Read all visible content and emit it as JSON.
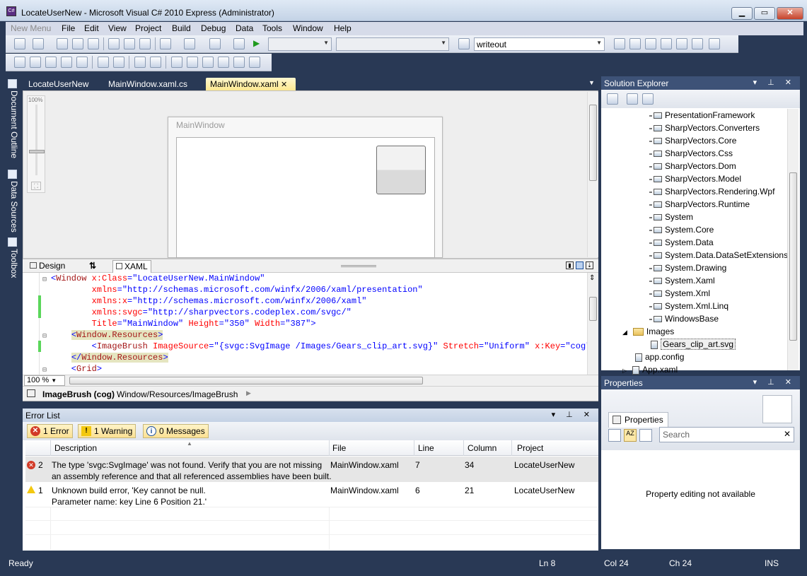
{
  "window": {
    "title": "LocateUserNew - Microsoft Visual C# 2010 Express (Administrator)",
    "app_icon": "C#"
  },
  "menu": {
    "items": [
      "New Menu",
      "File",
      "Edit",
      "View",
      "Project",
      "Build",
      "Debug",
      "Data",
      "Tools",
      "Window",
      "Help"
    ]
  },
  "toolbar": {
    "find_value": "writeout"
  },
  "left_tabs": [
    "Document Outline",
    "Data Sources",
    "Toolbox"
  ],
  "doc_tabs": [
    {
      "label": "LocateUserNew"
    },
    {
      "label": "MainWindow.xaml.cs"
    },
    {
      "label": "MainWindow.xaml",
      "active": true
    }
  ],
  "designer": {
    "zoom_label": "100%",
    "window_title": "MainWindow"
  },
  "split_tabs": {
    "design": "Design",
    "swap": "⇅",
    "xaml": "XAML"
  },
  "code": {
    "lines": [
      {
        "parts": [
          {
            "t": "<",
            "c": "g"
          },
          {
            "t": "Window",
            "c": "r"
          },
          {
            "t": " x:Class",
            "c": "at"
          },
          {
            "t": "=",
            "c": "g"
          },
          {
            "t": "\"LocateUserNew.MainWindow\"",
            "c": "g"
          }
        ]
      },
      {
        "parts": [
          {
            "t": "        xmlns",
            "c": "at"
          },
          {
            "t": "=",
            "c": "g"
          },
          {
            "t": "\"http://schemas.microsoft.com/winfx/2006/xaml/presentation\"",
            "c": "g"
          }
        ]
      },
      {
        "parts": [
          {
            "t": "        xmlns:x",
            "c": "at"
          },
          {
            "t": "=",
            "c": "g"
          },
          {
            "t": "\"http://schemas.microsoft.com/winfx/2006/xaml\"",
            "c": "g"
          }
        ]
      },
      {
        "parts": [
          {
            "t": "        xmlns:svgc",
            "c": "at"
          },
          {
            "t": "=",
            "c": "g"
          },
          {
            "t": "\"http://sharpvectors.codeplex.com/svgc/\"",
            "c": "g"
          }
        ]
      },
      {
        "parts": [
          {
            "t": "        Title",
            "c": "at"
          },
          {
            "t": "=",
            "c": "g"
          },
          {
            "t": "\"MainWindow\"",
            "c": "g"
          },
          {
            "t": " Height",
            "c": "at"
          },
          {
            "t": "=",
            "c": "g"
          },
          {
            "t": "\"350\"",
            "c": "g"
          },
          {
            "t": " Width",
            "c": "at"
          },
          {
            "t": "=",
            "c": "g"
          },
          {
            "t": "\"387\"",
            "c": "g"
          },
          {
            "t": ">",
            "c": "g"
          }
        ]
      },
      {
        "parts": [
          {
            "t": "    ",
            "c": ""
          },
          {
            "t": "<",
            "c": "g hl"
          },
          {
            "t": "Window.Resources",
            "c": "r hl"
          },
          {
            "t": ">",
            "c": "g hl"
          }
        ]
      },
      {
        "parts": [
          {
            "t": "        <",
            "c": "g"
          },
          {
            "t": "ImageBrush",
            "c": "r"
          },
          {
            "t": " ImageSource",
            "c": "at"
          },
          {
            "t": "=",
            "c": "g"
          },
          {
            "t": "\"{svgc:SvgImage /Images/Gears_clip_art.svg}\"",
            "c": "g"
          },
          {
            "t": " Stretch",
            "c": "at"
          },
          {
            "t": "=",
            "c": "g"
          },
          {
            "t": "\"Uniform\"",
            "c": "g"
          },
          {
            "t": " x:Key",
            "c": "at"
          },
          {
            "t": "=",
            "c": "g"
          },
          {
            "t": "\"cog\"",
            "c": "g"
          },
          {
            "t": " /",
            "c": "g"
          }
        ]
      },
      {
        "parts": [
          {
            "t": "    ",
            "c": ""
          },
          {
            "t": "</",
            "c": "g hl"
          },
          {
            "t": "Window.Resources",
            "c": "r hl"
          },
          {
            "t": ">",
            "c": "g hl"
          }
        ]
      },
      {
        "parts": [
          {
            "t": "    <",
            "c": "g"
          },
          {
            "t": "Grid",
            "c": "r"
          },
          {
            "t": ">",
            "c": "g"
          }
        ]
      }
    ],
    "zoom": "100 %"
  },
  "breadcrumb": {
    "bold": "ImageBrush (cog)",
    "path": "Window/Resources/ImageBrush"
  },
  "error_list": {
    "title": "Error List",
    "tabs": [
      {
        "label": "1 Error",
        "kind": "error"
      },
      {
        "label": "1 Warning",
        "kind": "warning"
      },
      {
        "label": "0 Messages",
        "kind": "info"
      }
    ],
    "columns": [
      "Description",
      "File",
      "Line",
      "Column",
      "Project"
    ],
    "rows": [
      {
        "kind": "error",
        "num": "2",
        "desc1": "The type 'svgc:SvgImage' was not found. Verify that you are not missing",
        "desc2": "an assembly reference and that all referenced assemblies have been built.",
        "file": "MainWindow.xaml",
        "line": "7",
        "column": "34",
        "project": "LocateUserNew"
      },
      {
        "kind": "warning",
        "num": "1",
        "desc1": "Unknown build error, 'Key cannot be null.",
        "desc2": "Parameter name: key Line 6 Position 21.'",
        "file": "MainWindow.xaml",
        "line": "6",
        "column": "21",
        "project": "LocateUserNew"
      }
    ]
  },
  "solution_explorer": {
    "title": "Solution Explorer",
    "refs": [
      "PresentationFramework",
      "SharpVectors.Converters",
      "SharpVectors.Core",
      "SharpVectors.Css",
      "SharpVectors.Dom",
      "SharpVectors.Model",
      "SharpVectors.Rendering.Wpf",
      "SharpVectors.Runtime",
      "System",
      "System.Core",
      "System.Data",
      "System.Data.DataSetExtensions",
      "System.Drawing",
      "System.Xaml",
      "System.Xml",
      "System.Xml.Linq",
      "WindowsBase"
    ],
    "folder": "Images",
    "file": "Gears_clip_art.svg",
    "app_config": "app.config",
    "app_xaml": "App.xaml"
  },
  "properties": {
    "title": "Properties",
    "tab": "Properties",
    "search_placeholder": "Search",
    "empty_msg": "Property editing not available"
  },
  "status": {
    "ready": "Ready",
    "ln": "Ln 8",
    "col": "Col 24",
    "ch": "Ch 24",
    "ins": "INS"
  }
}
